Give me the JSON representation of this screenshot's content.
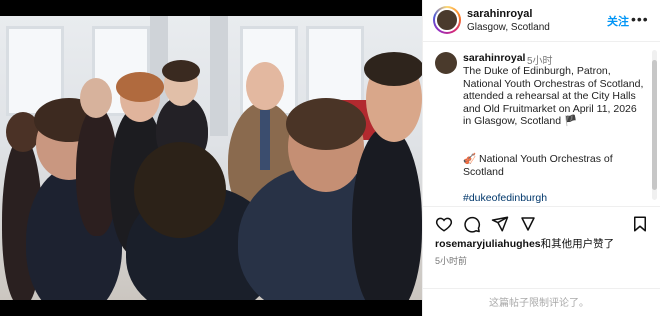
{
  "post": {
    "author": "sarahinroyal",
    "location": "Glasgow, Scotland",
    "follow_label": "关注",
    "more_icon": "more-horizontal-icon",
    "photo_alt": "The Duke of Edinburgh with members of the National Youth Orchestras of Scotland"
  },
  "caption": {
    "author": "sarahinroyal",
    "time": "5小时",
    "text": "The Duke of Edinburgh, Patron, National Youth Orchestras of Scotland, attended a rehearsal at the City Halls and Old Fruitmarket on April 11, 2026 in Glasgow, Scotland 🏴",
    "orchestra_line": "🎻 National Youth Orchestras of Scotland",
    "hashtag": "#dukeofedinburgh"
  },
  "actions": {
    "icons": [
      "heart-icon",
      "comment-icon",
      "share-icon",
      "bookmark-icon"
    ]
  },
  "likes": {
    "user": "rosemaryjuliahughes",
    "suffix": "和其他用户赞了"
  },
  "timestamp": "5小时前",
  "comments_disabled": "这篇帖子限制评论了。",
  "colors": {
    "link": "#0095f6",
    "hashtag": "#00376b",
    "muted": "#777777"
  }
}
